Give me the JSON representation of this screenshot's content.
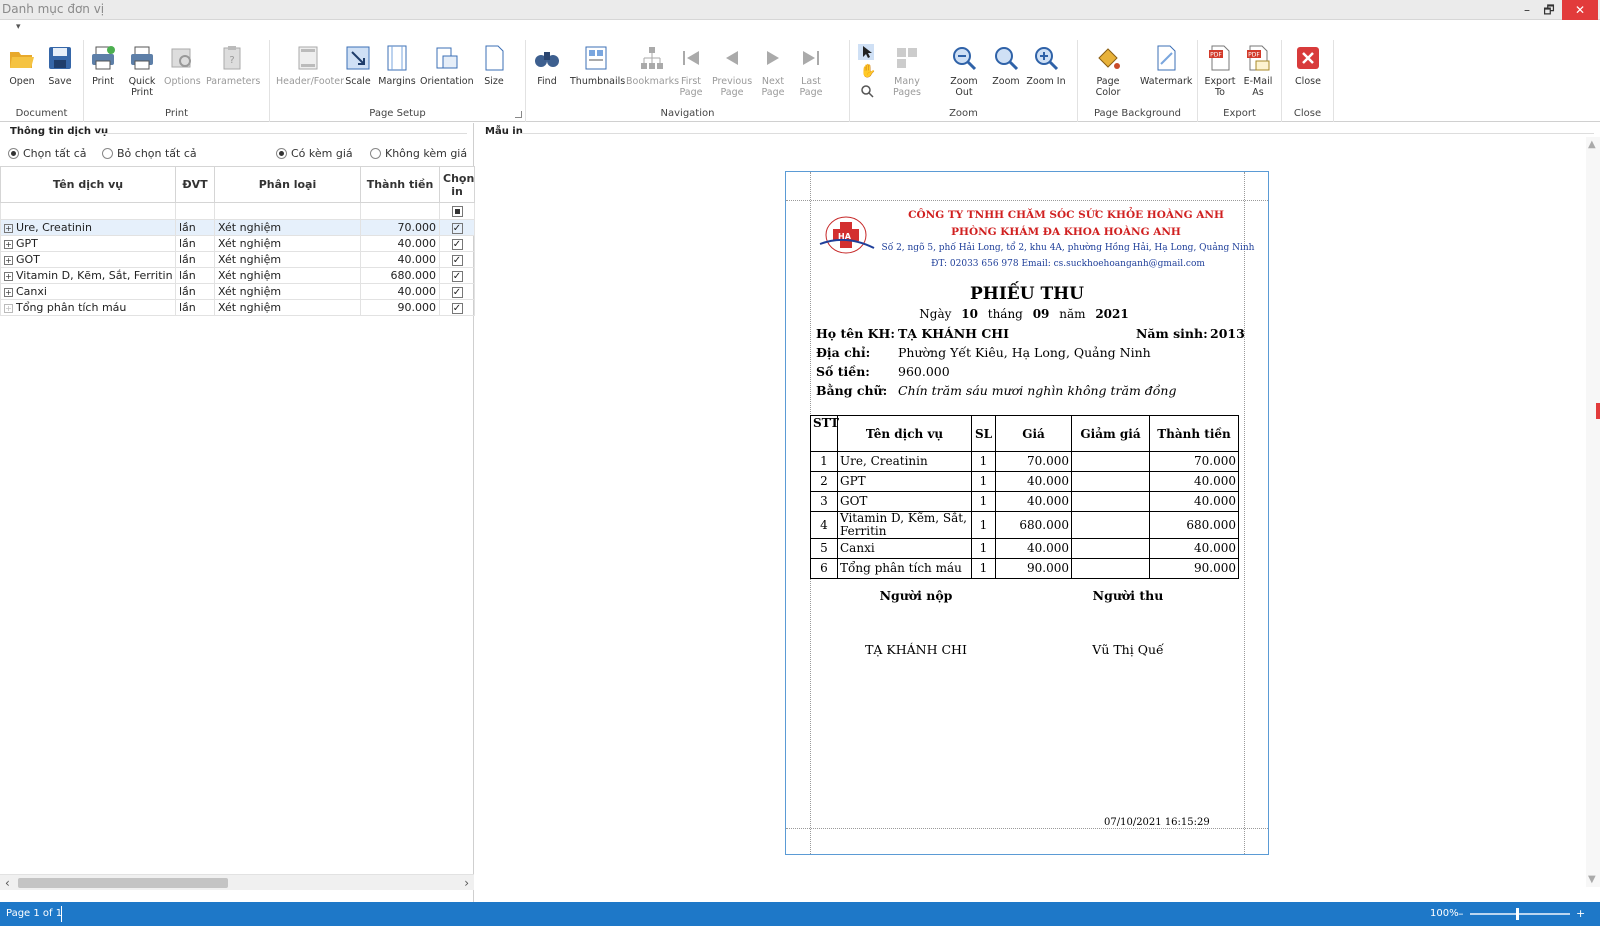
{
  "window": {
    "title": "Danh mục đơn vị",
    "qat_glyph": "▾",
    "min": "–",
    "restore": "🗗",
    "close": "✕"
  },
  "ribbon": {
    "groups": [
      "Document",
      "Print",
      "Page Setup",
      "Navigation",
      "Zoom",
      "Page Background",
      "Export",
      "Close"
    ],
    "buttons": {
      "open": "Open",
      "save": "Save",
      "print": "Print",
      "quick_print_1": "Quick",
      "quick_print_2": "Print",
      "options": "Options",
      "parameters": "Parameters",
      "header_footer": "Header/Footer",
      "scale": "Scale",
      "margins": "Margins",
      "orientation": "Orientation",
      "size": "Size",
      "find": "Find",
      "thumbnails": "Thumbnails",
      "bookmarks": "Bookmarks",
      "first_1": "First",
      "first_2": "Page",
      "prev_1": "Previous",
      "prev_2": "Page",
      "next_1": "Next",
      "next_2": "Page",
      "last_1": "Last",
      "last_2": "Page",
      "many_pages": "Many Pages",
      "zoom_out": "Zoom Out",
      "zoom": "Zoom",
      "zoom_in": "Zoom In",
      "page_color": "Page Color",
      "watermark": "Watermark",
      "export_1": "Export",
      "export_2": "To",
      "email_1": "E-Mail",
      "email_2": "As",
      "close": "Close"
    }
  },
  "left_panel": {
    "heading": "Thông tin dịch vụ",
    "radios": {
      "select_all": "Chọn tất cả",
      "deselect_all": "Bỏ chọn tất cả",
      "with_price": "Có kèm giá",
      "without_price": "Không kèm giá"
    },
    "columns": {
      "name": "Tên dịch vụ",
      "unit": "ĐVT",
      "category": "Phân loại",
      "amount": "Thành tiền",
      "print_1": "Chọn",
      "print_2": "in"
    },
    "rows": [
      {
        "name": "Ure, Creatinin",
        "unit": "lần",
        "category": "Xét nghiệm",
        "amount": "70.000",
        "checked": "✓"
      },
      {
        "name": "GPT",
        "unit": "lần",
        "category": "Xét nghiệm",
        "amount": "40.000",
        "checked": "✓"
      },
      {
        "name": "GOT",
        "unit": "lần",
        "category": "Xét nghiệm",
        "amount": "40.000",
        "checked": "✓"
      },
      {
        "name": "Vitamin D, Kẽm, Sắt, Ferritin",
        "unit": "lần",
        "category": "Xét nghiệm",
        "amount": "680.000",
        "checked": "✓"
      },
      {
        "name": "Canxi",
        "unit": "lần",
        "category": "Xét nghiệm",
        "amount": "40.000",
        "checked": "✓"
      },
      {
        "name": "Tổng phân tích máu",
        "unit": "lần",
        "category": "Xét nghiệm",
        "amount": "90.000",
        "checked": "✓"
      }
    ],
    "expander": "+",
    "scroll_left": "‹",
    "scroll_right": "›"
  },
  "right_panel": {
    "heading": "Mẫu in",
    "receipt": {
      "logo_text": "HA",
      "company_1": "CÔNG TY TNHH CHĂM SÓC SỨC KHỎE HOÀNG ANH",
      "company_2": "PHÒNG KHÁM ĐA KHOA HOÀNG ANH",
      "address": "Số 2, ngõ 5, phố Hải Long, tổ 2, khu 4A, phường Hồng Hải, Hạ Long, Quảng Ninh",
      "contact": "ĐT: 02033 656 978 Email: cs.suckhoehoanganh@gmail.com",
      "title": "PHIẾU THU",
      "date": {
        "l_day": "Ngày",
        "day": "10",
        "l_month": "tháng",
        "month": "09",
        "l_year": "năm",
        "year": "2021"
      },
      "name_label": "Họ tên KH:",
      "name": "TẠ KHÁNH CHI",
      "birth_label": "Năm sinh:",
      "birth": "2013",
      "addr_label": "Địa chỉ:",
      "addr": "Phường Yết Kiêu, Hạ Long, Quảng Ninh",
      "amount_label": "Số tiền:",
      "amount": "960.000",
      "words_label": "Bằng chữ:",
      "words": "Chín trăm sáu mươi nghìn không trăm đồng",
      "columns": {
        "stt": "STT",
        "name": "Tên dịch vụ",
        "qty": "SL",
        "price": "Giá",
        "discount": "Giảm giá",
        "total": "Thành tiền"
      },
      "items": [
        {
          "stt": "1",
          "name": "Ure, Creatinin",
          "qty": "1",
          "price": "70.000",
          "discount": "",
          "total": "70.000"
        },
        {
          "stt": "2",
          "name": "GPT",
          "qty": "1",
          "price": "40.000",
          "discount": "",
          "total": "40.000"
        },
        {
          "stt": "3",
          "name": "GOT",
          "qty": "1",
          "price": "40.000",
          "discount": "",
          "total": "40.000"
        },
        {
          "stt": "4",
          "name": "Vitamin D, Kẽm, Sắt, Ferritin",
          "qty": "1",
          "price": "680.000",
          "discount": "",
          "total": "680.000"
        },
        {
          "stt": "5",
          "name": "Canxi",
          "qty": "1",
          "price": "40.000",
          "discount": "",
          "total": "40.000"
        },
        {
          "stt": "6",
          "name": "Tổng phân tích máu",
          "qty": "1",
          "price": "90.000",
          "discount": "",
          "total": "90.000"
        }
      ],
      "payer_label": "Người nộp",
      "collector_label": "Người thu",
      "payer": "TẠ KHÁNH CHI",
      "collector": "Vũ Thị Quế",
      "printed_at": "07/10/2021 16:15:29"
    }
  },
  "status": {
    "page": "Page 1 of 1",
    "zoom": "100%",
    "zoom_minus": "–",
    "zoom_plus": "+"
  },
  "colors": {
    "accent": "#1e78c8",
    "company_red": "#d02020",
    "address_blue": "#1f3f9a",
    "paper_border": "#5b9bd5"
  }
}
